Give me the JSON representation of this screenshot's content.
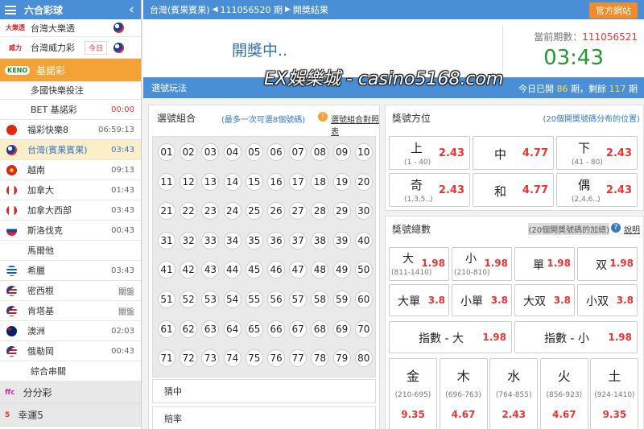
{
  "sidebar": {
    "title": "六合彩球",
    "items": [
      {
        "label": "台灣大樂透",
        "right": "",
        "logo": "大樂透"
      },
      {
        "label": "台灣威力彩",
        "right": "今日",
        "logo": "威力"
      },
      {
        "label": "基諾彩",
        "right": "",
        "logo": "KENO"
      },
      {
        "label": "多國快樂投注",
        "right": ""
      },
      {
        "label": "BET 基諾彩",
        "right": "00:00"
      },
      {
        "label": "福彩快樂8",
        "right": "06:59:13"
      },
      {
        "label": "台灣(賓果賓果)",
        "right": "03:43"
      },
      {
        "label": "越南",
        "right": "09:13"
      },
      {
        "label": "加拿大",
        "right": "01:43"
      },
      {
        "label": "加拿大西部",
        "right": "03:43"
      },
      {
        "label": "斯洛伐克",
        "right": "00:43"
      },
      {
        "label": "馬爾他",
        "right": ""
      },
      {
        "label": "希臘",
        "right": "03:43"
      },
      {
        "label": "密西根",
        "right": "關盤"
      },
      {
        "label": "肯塔基",
        "right": "關盤"
      },
      {
        "label": "澳洲",
        "right": "02:03"
      },
      {
        "label": "俄勒岡",
        "right": "00:43"
      },
      {
        "label": "綜合串關",
        "right": ""
      },
      {
        "label": "分分彩",
        "right": ""
      },
      {
        "label": "幸運5",
        "right": ""
      }
    ]
  },
  "header": {
    "lottery": "台灣(賓果賓果)",
    "period": "111056520 期",
    "result_link": "開獎結果",
    "official_button": "官方網站"
  },
  "draw": {
    "status": "開獎中..",
    "current_label": "當前期數：",
    "current_period": "111056521",
    "countdown": "03:43"
  },
  "watermark": "EX娛樂城 - casino5168.com",
  "bar": {
    "label": "選號玩法",
    "stats_prefix": "今日已開",
    "opened": "86",
    "stats_mid": "期，剩餘",
    "remain": "117",
    "stats_suffix": "期"
  },
  "numbers": {
    "title": "選號組合",
    "hint": "(最多一次可選8個號碼)",
    "warn_icon": "!",
    "link": "選號組合對照表",
    "balls": [
      "01",
      "02",
      "03",
      "04",
      "05",
      "06",
      "07",
      "08",
      "09",
      "10",
      "11",
      "12",
      "13",
      "14",
      "15",
      "16",
      "17",
      "18",
      "19",
      "20",
      "21",
      "22",
      "23",
      "24",
      "25",
      "26",
      "27",
      "28",
      "29",
      "30",
      "31",
      "32",
      "33",
      "34",
      "35",
      "36",
      "37",
      "38",
      "39",
      "40",
      "41",
      "42",
      "43",
      "44",
      "45",
      "46",
      "47",
      "48",
      "49",
      "50",
      "51",
      "52",
      "53",
      "54",
      "55",
      "56",
      "57",
      "58",
      "59",
      "60",
      "61",
      "62",
      "63",
      "64",
      "65",
      "66",
      "67",
      "68",
      "69",
      "70",
      "71",
      "72",
      "73",
      "74",
      "75",
      "76",
      "77",
      "78",
      "79",
      "80"
    ],
    "hit_label": "猜中",
    "odds_label": "賠率"
  },
  "position": {
    "title": "獎號方位",
    "note": "(20個開獎號碼分布的位置)",
    "cells": [
      {
        "name": "上",
        "range": "(1 - 40)",
        "odds": "2.43"
      },
      {
        "name": "中",
        "range": "",
        "odds": "4.77"
      },
      {
        "name": "下",
        "range": "(41 - 80)",
        "odds": "2.43"
      },
      {
        "name": "奇",
        "range": "(1,3,5..)",
        "odds": "2.43"
      },
      {
        "name": "和",
        "range": "",
        "odds": "4.77"
      },
      {
        "name": "偶",
        "range": "(2,4,6..)",
        "odds": "2.43"
      }
    ]
  },
  "sum": {
    "title": "獎號總數",
    "note": "(20個開獎號碼的加總)",
    "help_icon": "?",
    "explain": "說明",
    "row1": [
      {
        "name": "大",
        "range": "(811-1410)",
        "odds": "1.98"
      },
      {
        "name": "小",
        "range": "(210-810)",
        "odds": "1.98"
      },
      {
        "name": "單",
        "range": "",
        "odds": "1.98"
      },
      {
        "name": "双",
        "range": "",
        "odds": "1.98"
      }
    ],
    "row2": [
      {
        "name": "大單",
        "odds": "3.8"
      },
      {
        "name": "小單",
        "odds": "3.8"
      },
      {
        "name": "大双",
        "odds": "3.8"
      },
      {
        "name": "小双",
        "odds": "3.8"
      }
    ],
    "row3": [
      {
        "name": "指數 - 大",
        "odds": "1.98"
      },
      {
        "name": "指數 - 小",
        "odds": "1.98"
      }
    ],
    "row4": [
      {
        "name": "金",
        "range": "(210-695)",
        "odds": "9.35"
      },
      {
        "name": "木",
        "range": "(696-763)",
        "odds": "4.67"
      },
      {
        "name": "水",
        "range": "(764-855)",
        "odds": "2.43"
      },
      {
        "name": "火",
        "range": "(856-923)",
        "odds": "4.67"
      },
      {
        "name": "土",
        "range": "(924-1410)",
        "odds": "9.35"
      }
    ]
  },
  "colors": {
    "accent": "#4a8fd6",
    "orange": "#f4a235",
    "red": "#e33333",
    "green": "#229933"
  }
}
